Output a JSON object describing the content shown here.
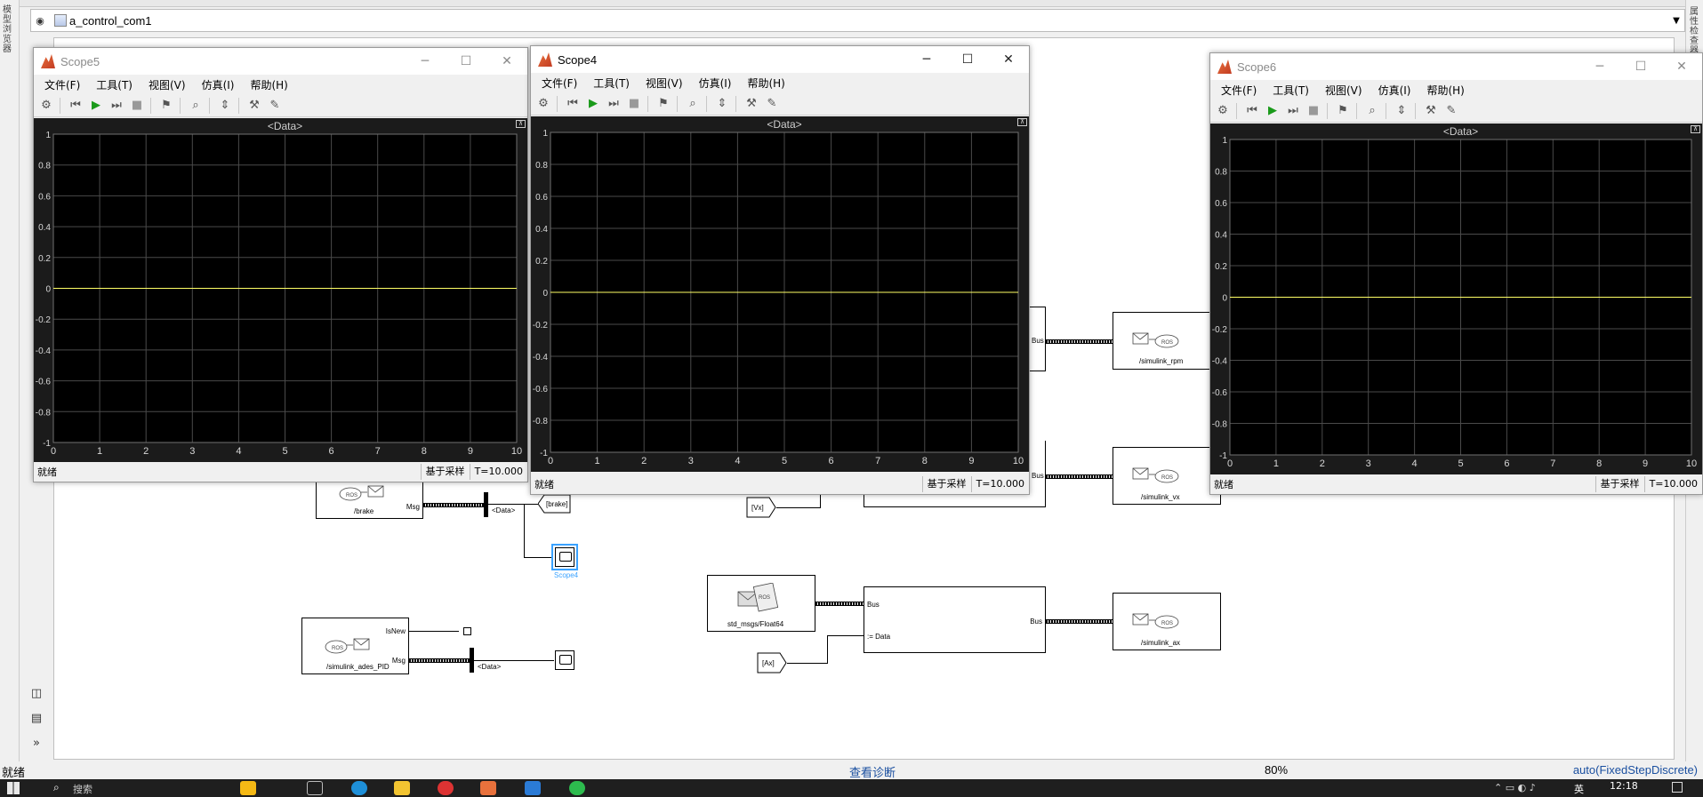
{
  "model": {
    "path": "a_control_com1",
    "left_panel_label": "模型浏览器",
    "right_panel_label": "属性检查器",
    "status_left": "就绪",
    "status_center": "查看诊断",
    "zoom": "80%",
    "solver": "auto(FixedStepDiscrete)"
  },
  "scope_menu": {
    "file": "文件(F)",
    "tools": "工具(T)",
    "view": "视图(V)",
    "simulation": "仿真(I)",
    "help": "帮助(H)"
  },
  "scopes": [
    {
      "title": "Scope5",
      "plot_title": "<Data>",
      "status": "就绪",
      "sample_mode": "基于采样",
      "time": "T=10.000"
    },
    {
      "title": "Scope4",
      "plot_title": "<Data>",
      "status": "就绪",
      "sample_mode": "基于采样",
      "time": "T=10.000"
    },
    {
      "title": "Scope6",
      "plot_title": "<Data>",
      "status": "就绪",
      "sample_mode": "基于采样",
      "time": "T=10.000"
    }
  ],
  "chart_data": {
    "type": "line",
    "title": "<Data>",
    "x": [
      0,
      10
    ],
    "series": [
      {
        "values": [
          0,
          0
        ]
      }
    ],
    "xlim": [
      0,
      10
    ],
    "ylim": [
      -1,
      1
    ],
    "x_ticks": [
      "0",
      "1",
      "2",
      "3",
      "4",
      "5",
      "6",
      "7",
      "8",
      "9",
      "10"
    ],
    "y_ticks": [
      "1",
      "0.8",
      "0.6",
      "0.4",
      "0.2",
      "0",
      "-0.2",
      "-0.4",
      "-0.6",
      "-0.8",
      "-1"
    ],
    "grid": true,
    "line_color": "#ffff66",
    "background": "#000000"
  },
  "diagram": {
    "brake_sub": {
      "topic": "/brake",
      "port": "Msg"
    },
    "brake_selector": "<Data>",
    "brake_goto": "[brake]",
    "brake_scope": "Scope4",
    "pid_sub": {
      "topic": "/simulink_ades_PID",
      "port_isnew": "IsNew",
      "port_msg": "Msg"
    },
    "pid_selector": "<Data>",
    "vx_from": "[Vx]",
    "ax_from": "[Ax]",
    "blank_msg": "std_msgs/Float64",
    "bus_assign": {
      "in_bus": "Bus",
      "in_data": ":= Data",
      "out_bus": "Bus"
    },
    "bus_rpm": "Bus",
    "bus_vx": "Bus",
    "pub_rpm": "/simulink_rpm",
    "pub_vx": "/simulink_vx",
    "pub_ax": "/simulink_ax",
    "ros_label": "ROS"
  },
  "taskbar": {
    "search": "搜索",
    "lang": "英",
    "clock": "12:18"
  }
}
